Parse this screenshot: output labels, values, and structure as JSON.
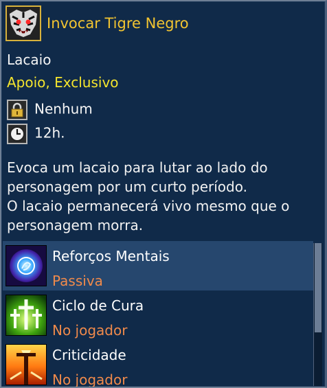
{
  "skill": {
    "title": "Invocar Tigre Negro",
    "type": "Lacaio",
    "tags": "Apoio, Exclusivo",
    "cost": "Nenhum",
    "cooldown": "12h.",
    "description": [
      "Evoca um lacaio para lutar ao lado do",
      "personagem por um curto período.",
      "O lacaio permanecerá vivo mesmo que o",
      "personagem morra."
    ]
  },
  "related": [
    {
      "name": "Reforços Mentais",
      "sub": "Passiva"
    },
    {
      "name": "Ciclo de Cura",
      "sub": "No jogador"
    },
    {
      "name": "Criticidade",
      "sub": "No jogador"
    }
  ],
  "icons": {
    "skill": "black-tiger-icon",
    "cost": "lock-icon",
    "cooldown": "clock-icon",
    "related": [
      "mental-orb-icon",
      "healing-crosses-icon",
      "flaming-sword-icon"
    ]
  },
  "colors": {
    "background": "#102a49",
    "title": "#f2c431",
    "tags": "#f5e52d",
    "subtext": "#f08a4b",
    "selected_row": "#26476e"
  }
}
